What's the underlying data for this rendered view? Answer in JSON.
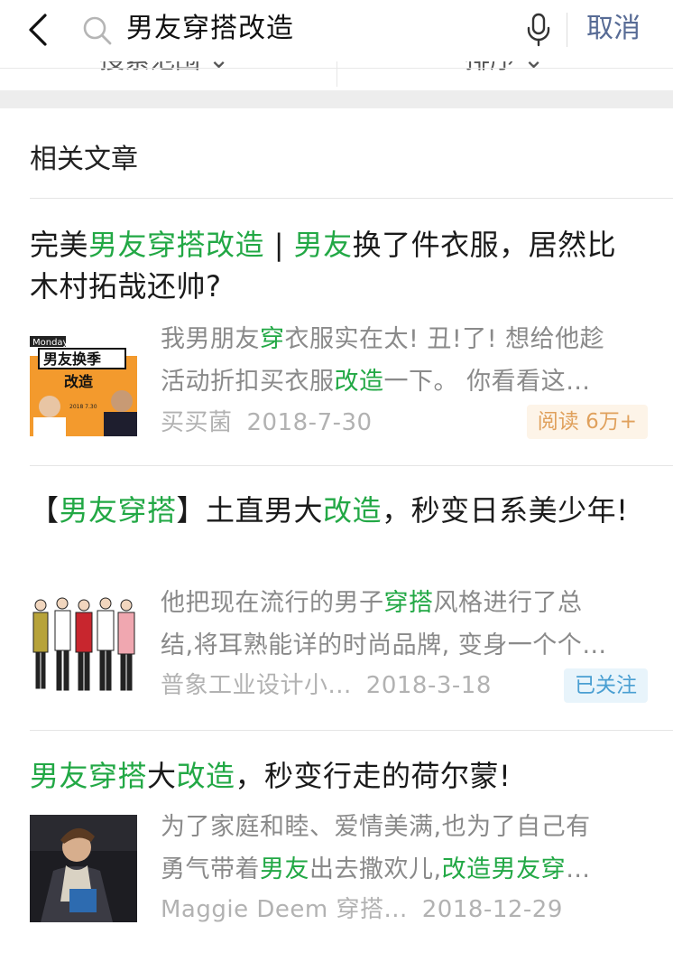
{
  "search": {
    "query": "男友穿搭改造",
    "cancel_label": "取消"
  },
  "filters": [
    {
      "label": "搜索范围 ⌄"
    },
    {
      "label": "排序 ⌄"
    }
  ],
  "section": {
    "title": "相关文章"
  },
  "articles": [
    {
      "title_parts": [
        {
          "text": "完美",
          "hl": false
        },
        {
          "text": "男友穿搭改造",
          "hl": true
        },
        {
          "text": " | ",
          "hl": false
        },
        {
          "text": "男友",
          "hl": true
        },
        {
          "text": "换了件衣服，居然比木村拓哉还帅?",
          "hl": false
        }
      ],
      "snippet_lines": [
        [
          {
            "text": "我男朋友",
            "hl": false
          },
          {
            "text": "穿",
            "hl": true
          },
          {
            "text": "衣服实在太! 丑!了! 想给他趁",
            "hl": false
          }
        ],
        [
          {
            "text": "活动折扣买衣服",
            "hl": false
          },
          {
            "text": "改造",
            "hl": true
          },
          {
            "text": "一下。 你看看这…",
            "hl": false
          }
        ]
      ],
      "source": "买买菌",
      "date": "2018-7-30",
      "badge": "阅读 6万+",
      "badge_type": "read",
      "thumb_text": {
        "tag": "Monday",
        "line1": "男友换季",
        "line2": "改造",
        "date": "2018 7.30"
      }
    },
    {
      "title_parts": [
        {
          "text": "【",
          "hl": false
        },
        {
          "text": "男友穿搭",
          "hl": true
        },
        {
          "text": "】土直男大",
          "hl": false
        },
        {
          "text": "改造",
          "hl": true
        },
        {
          "text": "，秒变日系美少年!",
          "hl": false
        }
      ],
      "snippet_lines": [
        [
          {
            "text": "他把现在流行的男子",
            "hl": false
          },
          {
            "text": "穿搭",
            "hl": true
          },
          {
            "text": "风格进行了总",
            "hl": false
          }
        ],
        [
          {
            "text": "结,将耳熟能详的时尚品牌, 变身一个个…",
            "hl": false
          }
        ]
      ],
      "source": "普象工业设计小...",
      "date": "2018-3-18",
      "badge": "已关注",
      "badge_type": "follow"
    },
    {
      "title_parts": [
        {
          "text": "男友穿搭",
          "hl": true
        },
        {
          "text": "大",
          "hl": false
        },
        {
          "text": "改造",
          "hl": true
        },
        {
          "text": "，秒变行走的荷尔蒙!",
          "hl": false
        }
      ],
      "snippet_lines": [
        [
          {
            "text": "为了家庭和睦、爱情美满,也为了自己有",
            "hl": false
          }
        ],
        [
          {
            "text": "勇气带着",
            "hl": false
          },
          {
            "text": "男友",
            "hl": true
          },
          {
            "text": "出去撒欢儿,",
            "hl": false
          },
          {
            "text": "改造男友穿",
            "hl": true
          },
          {
            "text": "…",
            "hl": false
          }
        ]
      ],
      "source": "Maggie Deem 穿搭...",
      "date": "2018-12-29",
      "badge": "",
      "badge_type": ""
    }
  ],
  "colors": {
    "highlight": "#22a845",
    "cancel": "#576b95",
    "read_badge_text": "#e0a15d",
    "follow_badge_text": "#4a9fd2"
  },
  "icons": [
    "back-arrow-icon",
    "search-icon",
    "microphone-icon"
  ]
}
